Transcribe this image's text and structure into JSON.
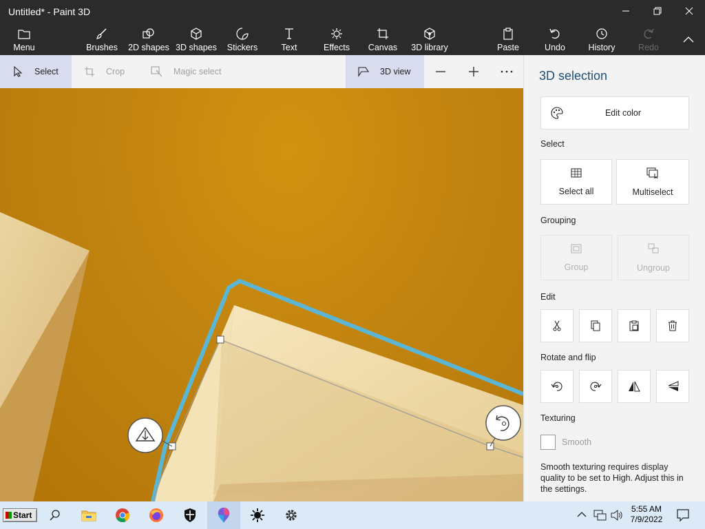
{
  "window": {
    "title": "Untitled* - Paint 3D",
    "controls": [
      "minimize",
      "maximize",
      "close"
    ]
  },
  "ribbon": {
    "menu": "Menu",
    "brushes": "Brushes",
    "shapes2d": "2D shapes",
    "shapes3d": "3D shapes",
    "stickers": "Stickers",
    "text": "Text",
    "effects": "Effects",
    "canvas": "Canvas",
    "library3d": "3D library",
    "paste": "Paste",
    "undo": "Undo",
    "history": "History",
    "redo": "Redo"
  },
  "toolbar": {
    "select": "Select",
    "crop": "Crop",
    "magic_select": "Magic select",
    "view3d": "3D view"
  },
  "panel": {
    "title": "3D selection",
    "edit_color": "Edit color",
    "select_heading": "Select",
    "select_all": "Select all",
    "multiselect": "Multiselect",
    "grouping_heading": "Grouping",
    "group": "Group",
    "ungroup": "Ungroup",
    "edit_heading": "Edit",
    "rotate_heading": "Rotate and flip",
    "texturing_heading": "Texturing",
    "smooth": "Smooth",
    "smooth_checked": false,
    "smooth_note": "Smooth texturing requires display quality to be set to High. Adjust this in the settings."
  },
  "taskbar": {
    "start": "Start",
    "time": "5:55 AM",
    "date": "7/9/2022",
    "pinned": [
      "search",
      "file-explorer",
      "chrome",
      "firefox",
      "security",
      "paint-3d",
      "brightness",
      "settings"
    ]
  },
  "colors": {
    "accent": "#1f4e79",
    "selection_outline": "#5bb6d6",
    "canvas_bg": "#c38510",
    "shape_light": "#f1ddb0"
  }
}
